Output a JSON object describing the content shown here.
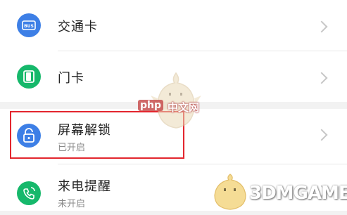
{
  "settings_list": {
    "items": [
      {
        "title": "交通卡",
        "subtitle": "",
        "icon": "bus-card-icon"
      },
      {
        "title": "门卡",
        "subtitle": "",
        "icon": "door-card-icon"
      },
      {
        "title": "屏幕解锁",
        "subtitle": "已开启",
        "icon": "unlock-icon"
      },
      {
        "title": "来电提醒",
        "subtitle": "未开启",
        "icon": "phone-ring-icon"
      }
    ]
  },
  "icon_badge": {
    "bus_text": "BUS"
  },
  "watermarks": {
    "php": "php",
    "php_site": "中文网",
    "game": "3DMGAME"
  },
  "colors": {
    "blue_icon": "#3d7fe6",
    "green_icon": "#16b86b",
    "highlight": "#e3262e"
  }
}
